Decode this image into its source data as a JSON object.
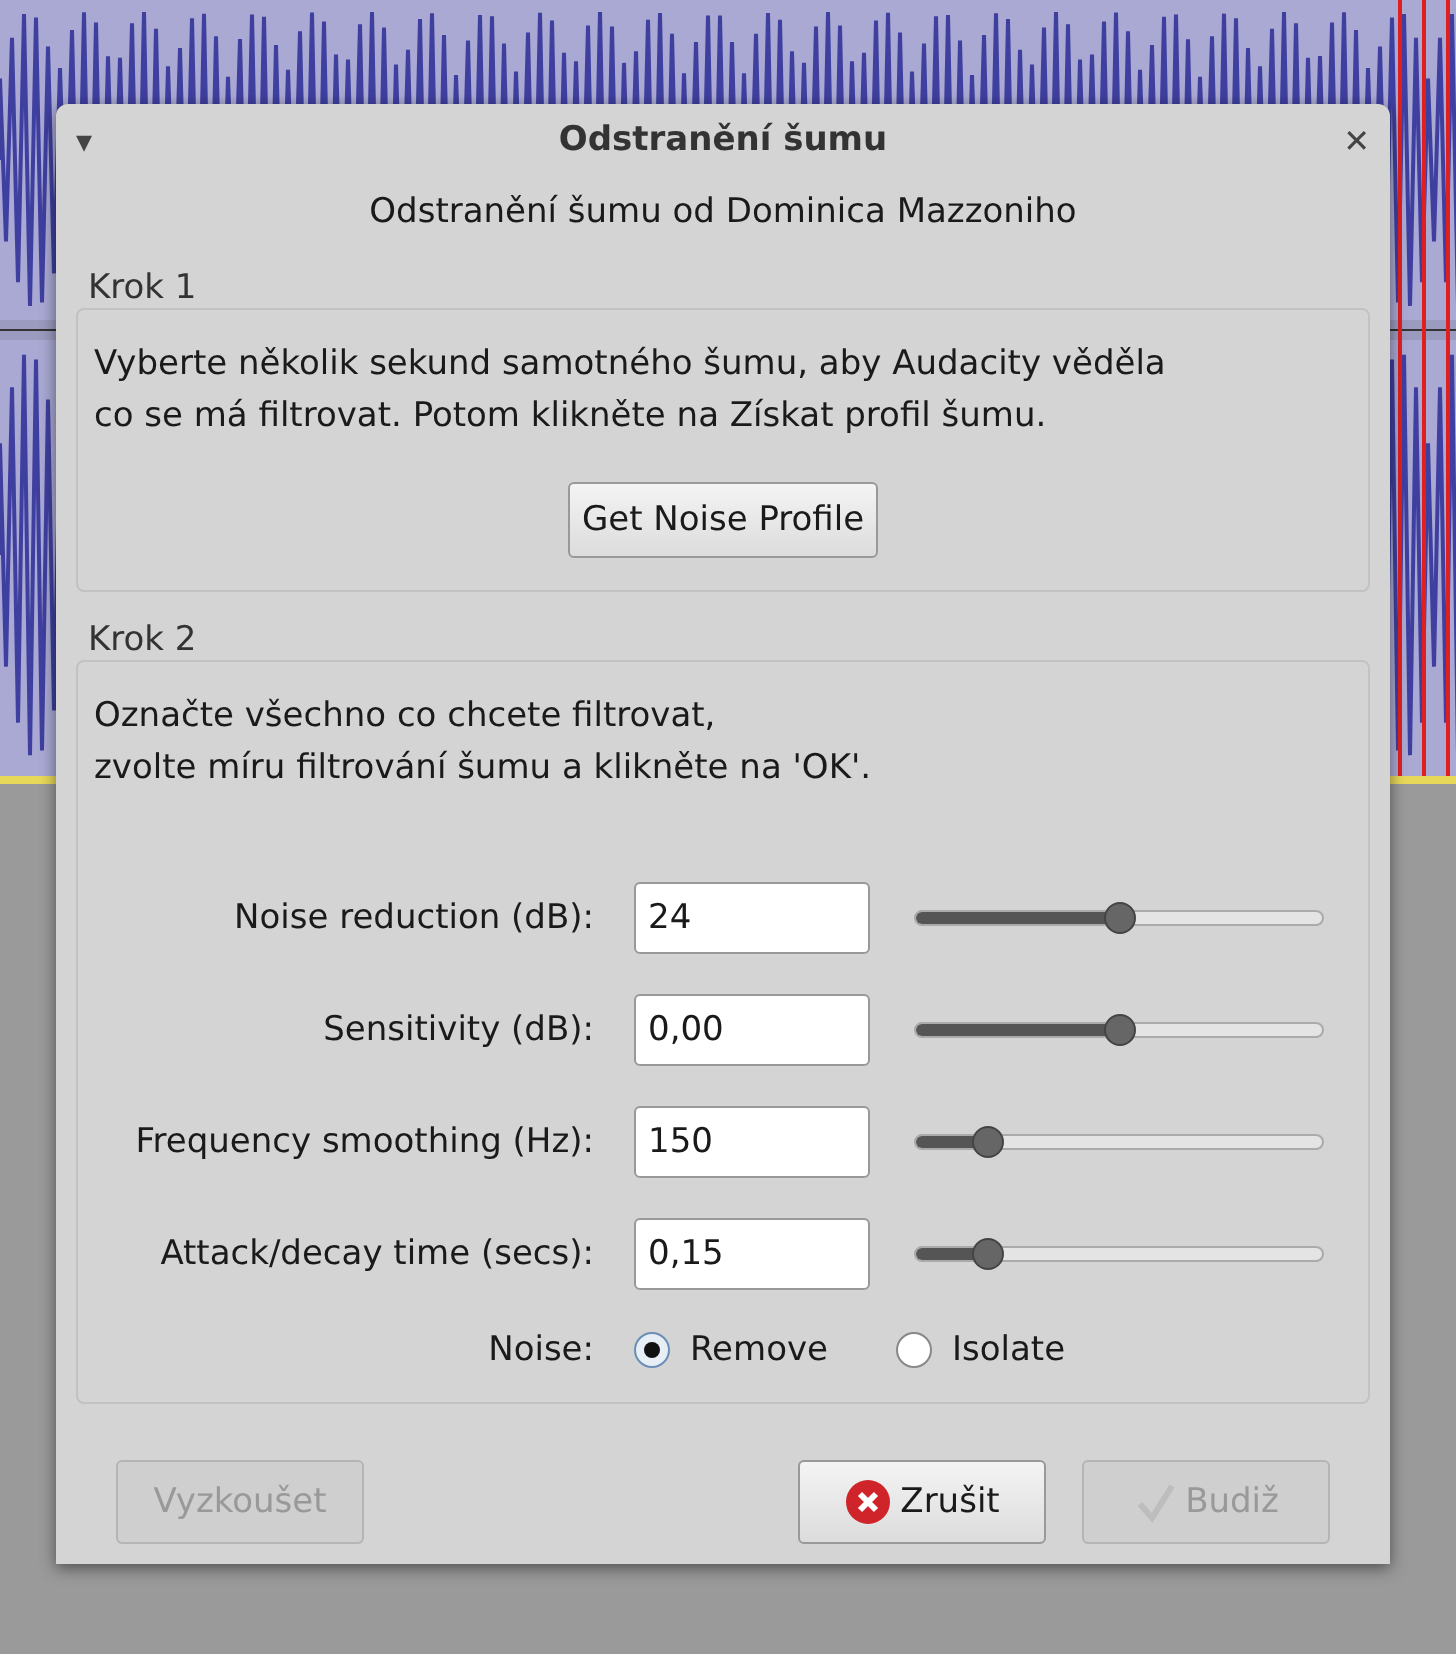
{
  "window": {
    "title": "Odstranění šumu",
    "menu_glyph": "▾",
    "close_glyph": "✕"
  },
  "heading": "Odstranění šumu od Dominica Mazzoniho",
  "step1": {
    "title": "Krok 1",
    "text": "Vyberte několik sekund samotného šumu, aby Audacity věděla\nco se má filtrovat. Potom klikněte na Získat profil šumu.",
    "button": "Get Noise Profile"
  },
  "step2": {
    "title": "Krok 2",
    "text": "Označte všechno co chcete filtrovat,\nzvolte míru filtrování šumu a klikněte na 'OK'.",
    "params": [
      {
        "label": "Noise reduction (dB):",
        "value": "24",
        "level": 0.5
      },
      {
        "label": "Sensitivity (dB):",
        "value": "0,00",
        "level": 0.5
      },
      {
        "label": "Frequency smoothing (Hz):",
        "value": "150",
        "level": 0.18
      },
      {
        "label": "Attack/decay time (secs):",
        "value": "0,15",
        "level": 0.18
      }
    ],
    "noise": {
      "label": "Noise:",
      "options": [
        {
          "label": "Remove",
          "selected": true
        },
        {
          "label": "Isolate",
          "selected": false
        }
      ]
    }
  },
  "buttons": [
    {
      "kind": "plain",
      "label": "Vyzkoušet",
      "disabled": true
    },
    {
      "kind": "cancel",
      "label": "Zrušit",
      "disabled": false
    },
    {
      "kind": "ok",
      "label": "Budiž",
      "disabled": true
    }
  ]
}
